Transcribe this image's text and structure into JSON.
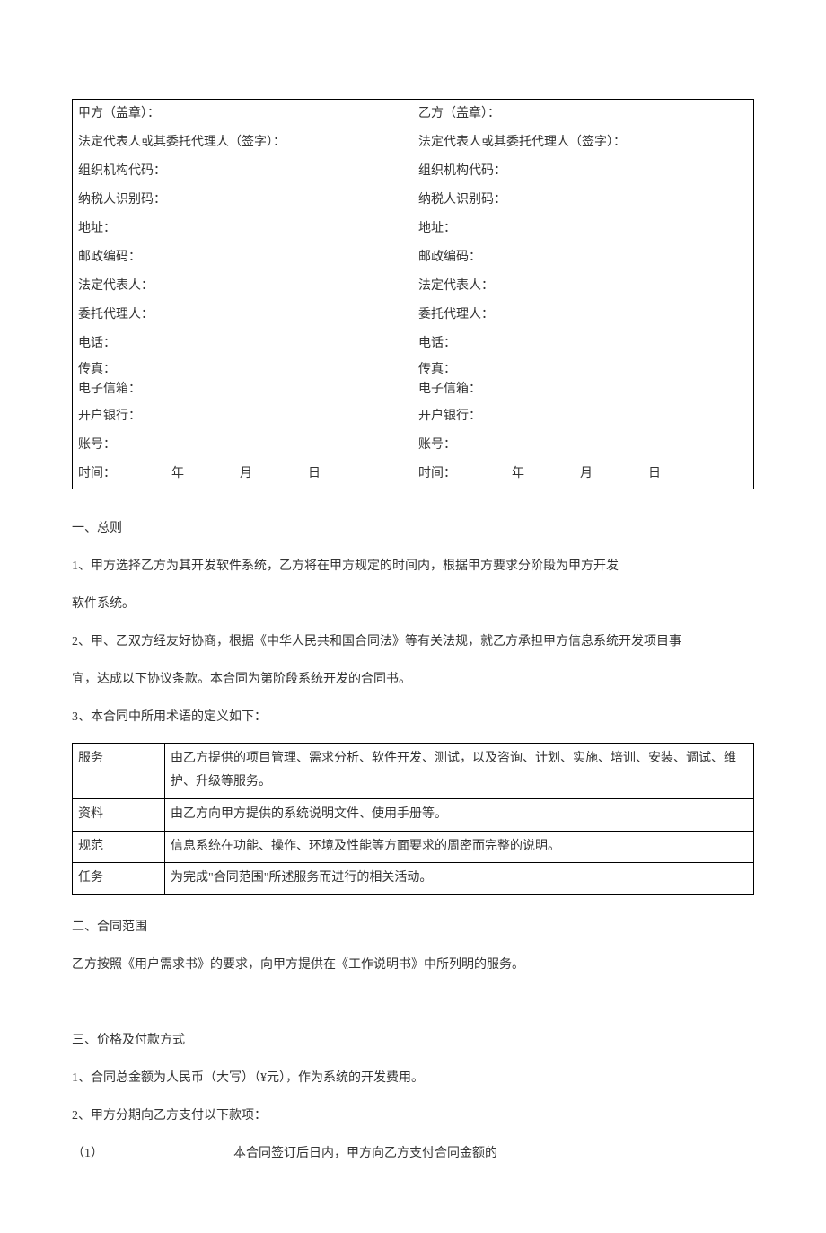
{
  "party_labels": {
    "a": {
      "header": "甲方（盖章）：",
      "legal_agent": "法定代表人或其委托代理人（签字）：",
      "org_code": "组织机构代码：",
      "tax_id": "纳税人识别码：",
      "address": "地址：",
      "postal": "邮政编码：",
      "legal_rep": "法定代表人：",
      "agent": "委托代理人：",
      "tel": "电话：",
      "fax": "传真：",
      "email": "电子信箱：",
      "bank": "开户银行：",
      "account": "账号：",
      "time_label": "时间：",
      "year": "年",
      "month": "月",
      "day": "日"
    },
    "b": {
      "header": "乙方（盖章）：",
      "legal_agent": "法定代表人或其委托代理人（签字）：",
      "org_code": "组织机构代码：",
      "tax_id": "纳税人识别码：",
      "address": "地址：",
      "postal": "邮政编码：",
      "legal_rep": "法定代表人：",
      "agent": "委托代理人：",
      "tel": "电话：",
      "fax": "传真：",
      "email": "电子信箱：",
      "bank": "开户银行：",
      "account": "账号：",
      "time_label": "时间：",
      "year": "年",
      "month": "月",
      "day": "日"
    }
  },
  "section1": {
    "heading": "一、总则",
    "p1a": "1、甲方选择乙方为其开发软件系统，乙方将在甲方规定的时间内，根据甲方要求分阶段为甲方开发",
    "p1b": "软件系统。",
    "p2a": "2、甲、乙双方经友好协商，根据《中华人民共和国合同法》等有关法规，就乙方承担甲方信息系统开发项目事",
    "p2b": "宜，达成以下协议条款。本合同为第阶段系统开发的合同书。",
    "p3": "3、本合同中所用术语的定义如下："
  },
  "terms": {
    "r1_name": "服务",
    "r1_desc": "由乙方提供的项目管理、需求分析、软件开发、测试，以及咨询、计划、实施、培训、安装、调试、维护、升级等服务。",
    "r2_name": "资料",
    "r2_desc": "由乙方向甲方提供的系统说明文件、使用手册等。",
    "r3_name": "规范",
    "r3_desc": "信息系统在功能、操作、环境及性能等方面要求的周密而完整的说明。",
    "r4_name": "任务",
    "r4_desc": "为完成\"合同范围\"所述服务而进行的相关活动。"
  },
  "section2": {
    "heading": "二、合同范围",
    "p1": "乙方按照《用户需求书》的要求，向甲方提供在《工作说明书》中所列明的服务。"
  },
  "section3": {
    "heading": "三、价格及付款方式",
    "p1": "1、合同总金额为人民币（大写）（¥元），作为系统的开发费用。",
    "p2": "2、甲方分期向乙方支付以下款项：",
    "p3_num": "（1）",
    "p3_text": "本合同签订后日内，甲方向乙方支付合同金额的"
  }
}
